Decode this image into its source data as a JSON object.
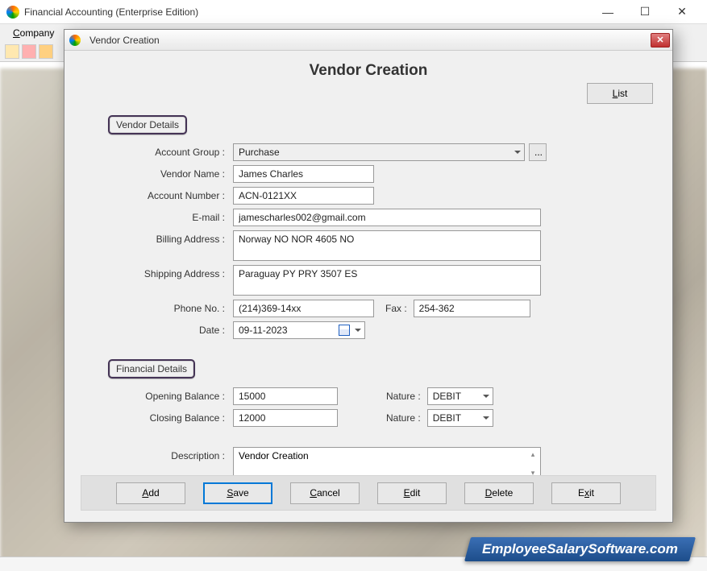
{
  "mainWindow": {
    "title": "Financial Accounting (Enterprise Edition)",
    "menu": {
      "company": "Company"
    }
  },
  "dialog": {
    "windowTitle": "Vendor Creation",
    "heading": "Vendor Creation",
    "listButton": "List",
    "sections": {
      "vendorDetails": "Vendor Details",
      "financialDetails": "Financial Details"
    },
    "labels": {
      "accountGroup": "Account Group :",
      "vendorName": "Vendor Name :",
      "accountNumber": "Account Number :",
      "email": "E-mail :",
      "billingAddress": "Billing Address :",
      "shippingAddress": "Shipping Address :",
      "phone": "Phone No. :",
      "fax": "Fax :",
      "date": "Date :",
      "openingBalance": "Opening Balance :",
      "closingBalance": "Closing Balance :",
      "nature": "Nature :",
      "description": "Description :"
    },
    "values": {
      "accountGroup": "Purchase",
      "vendorName": "James Charles",
      "accountNumber": "ACN-0121XX",
      "email": "jamescharles002@gmail.com",
      "billingAddress": "Norway NO NOR 4605 NO",
      "shippingAddress": "Paraguay PY PRY 3507 ES",
      "phone": "(214)369-14xx",
      "fax": "254-362",
      "date": "09-11-2023",
      "openingBalance": "15000",
      "openingNature": "DEBIT",
      "closingBalance": "12000",
      "closingNature": "DEBIT",
      "description": "Vendor Creation",
      "ellipsis": "..."
    },
    "buttons": {
      "add": "Add",
      "save": "Save",
      "cancel": "Cancel",
      "edit": "Edit",
      "delete": "Delete",
      "exit": "Exit"
    }
  },
  "watermark": "EmployeeSalarySoftware.com"
}
